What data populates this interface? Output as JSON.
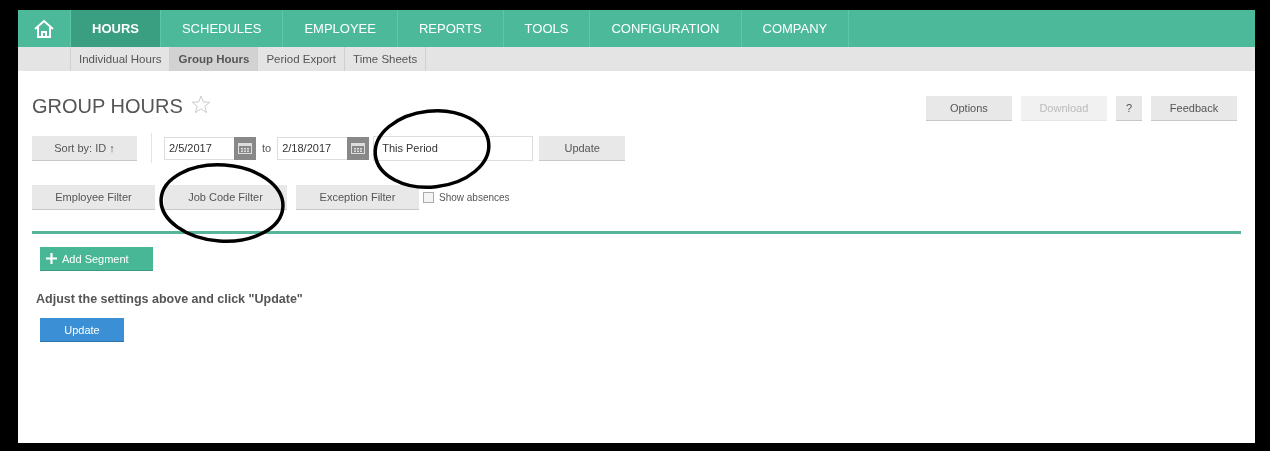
{
  "nav": {
    "items": [
      {
        "label": "HOURS",
        "selected": true
      },
      {
        "label": "SCHEDULES",
        "selected": false
      },
      {
        "label": "EMPLOYEE",
        "selected": false
      },
      {
        "label": "REPORTS",
        "selected": false
      },
      {
        "label": "TOOLS",
        "selected": false
      },
      {
        "label": "CONFIGURATION",
        "selected": false
      },
      {
        "label": "COMPANY",
        "selected": false
      }
    ]
  },
  "subnav": {
    "items": [
      {
        "label": "Individual Hours",
        "selected": false
      },
      {
        "label": "Group Hours",
        "selected": true
      },
      {
        "label": "Period Export",
        "selected": false
      },
      {
        "label": "Time Sheets",
        "selected": false
      }
    ]
  },
  "page": {
    "title": "GROUP HOURS",
    "favorite": false
  },
  "actions": [
    {
      "label": "Options",
      "disabled": false
    },
    {
      "label": "Download",
      "disabled": true
    },
    {
      "label": "?",
      "disabled": false
    },
    {
      "label": "Feedback",
      "disabled": false
    }
  ],
  "controls": {
    "sort": "Sort by: ID ↑",
    "start_date": "2/5/2017",
    "to": "to",
    "end_date": "2/18/2017",
    "period": "This Period",
    "update": "Update"
  },
  "filters": [
    {
      "label": "Employee Filter"
    },
    {
      "label": "Job Code Filter"
    },
    {
      "label": "Exception Filter"
    }
  ],
  "show_absences": {
    "label": "Show absences",
    "checked": false
  },
  "add_segment": "Add Segment",
  "message": "Adjust the settings above and click \"Update\"",
  "update_button": "Update"
}
